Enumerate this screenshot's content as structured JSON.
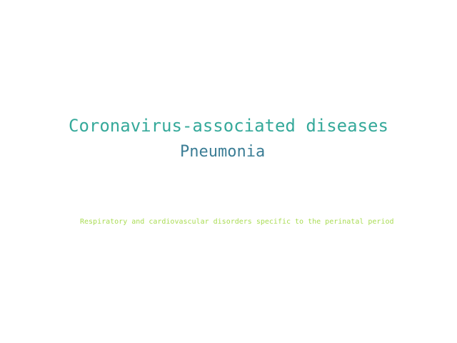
{
  "word_cloud": {
    "words": [
      {
        "text": "Coronavirus-associated diseases",
        "color": "#35a99a"
      },
      {
        "text": "Pneumonia",
        "color": "#3b7d95"
      },
      {
        "text": "Respiratory and cardiovascular disorders specific to the perinatal period",
        "color": "#a9dc53"
      }
    ]
  }
}
